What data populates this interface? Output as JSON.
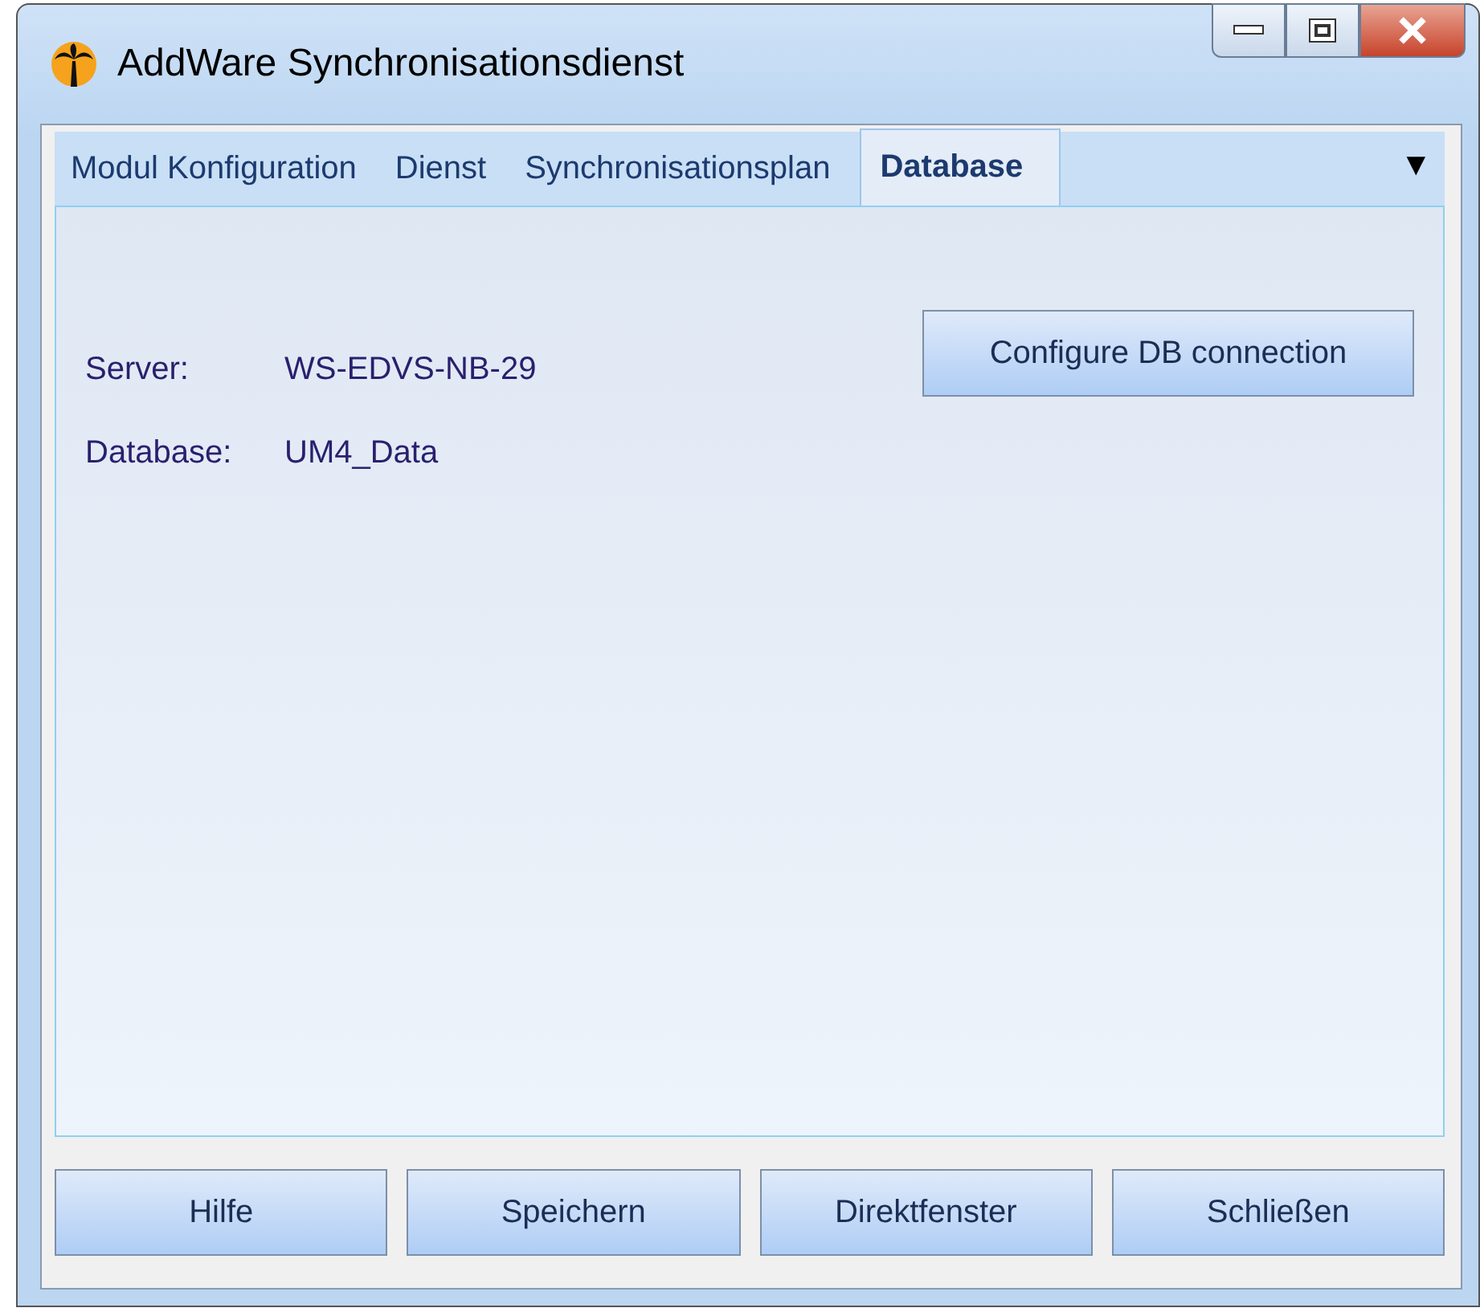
{
  "window": {
    "title": "AddWare Synchronisationsdienst"
  },
  "tabs": [
    {
      "label": "Modul Konfiguration",
      "selected": false
    },
    {
      "label": "Dienst",
      "selected": false
    },
    {
      "label": "Synchronisationsplan",
      "selected": false
    },
    {
      "label": "Database",
      "selected": true
    }
  ],
  "tab_overflow": "▼",
  "fields": [
    {
      "label": "Server:",
      "value": "WS-EDVS-NB-29"
    },
    {
      "label": "Database:",
      "value": "UM4_Data"
    }
  ],
  "configure_button": "Configure DB connection",
  "buttons": [
    "Hilfe",
    "Speichern",
    "Direktfenster",
    "Schließen"
  ]
}
